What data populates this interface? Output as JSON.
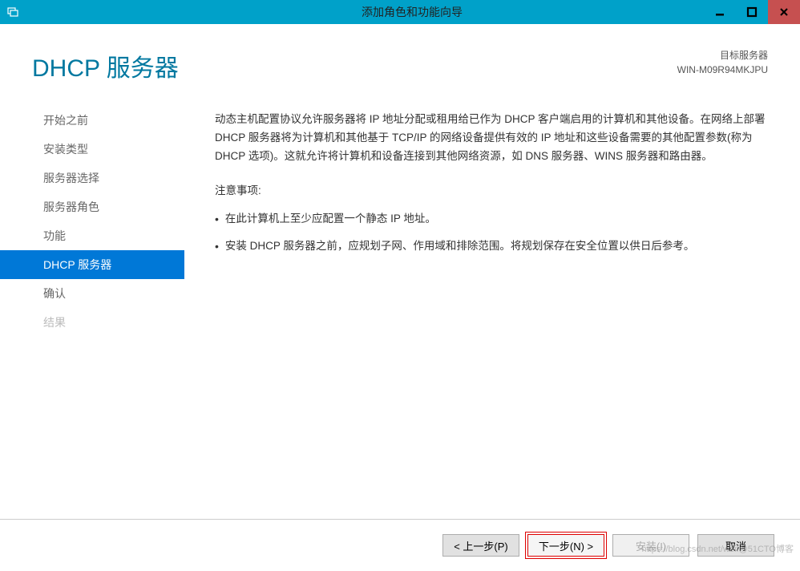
{
  "titlebar": {
    "title": "添加角色和功能向导"
  },
  "header": {
    "page_title": "DHCP 服务器",
    "target_label": "目标服务器",
    "target_name": "WIN-M09R94MKJPU"
  },
  "sidebar": {
    "items": [
      {
        "label": "开始之前"
      },
      {
        "label": "安装类型"
      },
      {
        "label": "服务器选择"
      },
      {
        "label": "服务器角色"
      },
      {
        "label": "功能"
      },
      {
        "label": "DHCP 服务器"
      },
      {
        "label": "确认"
      },
      {
        "label": "结果"
      }
    ]
  },
  "content": {
    "description": "动态主机配置协议允许服务器将 IP 地址分配或租用给已作为 DHCP 客户端启用的计算机和其他设备。在网络上部署 DHCP 服务器将为计算机和其他基于 TCP/IP 的网络设备提供有效的 IP 地址和这些设备需要的其他配置参数(称为 DHCP 选项)。这就允许将计算机和设备连接到其他网络资源，如 DNS 服务器、WINS 服务器和路由器。",
    "notice_title": "注意事项:",
    "notice_items": [
      "在此计算机上至少应配置一个静态 IP 地址。",
      "安装 DHCP 服务器之前，应规划子网、作用域和排除范围。将规划保存在安全位置以供日后参考。"
    ]
  },
  "footer": {
    "previous": "< 上一步(P)",
    "next": "下一步(N) >",
    "install": "安装(I)",
    "cancel": "取消"
  },
  "watermark": "https://blog.csdn.net/weif@51CTO博客"
}
